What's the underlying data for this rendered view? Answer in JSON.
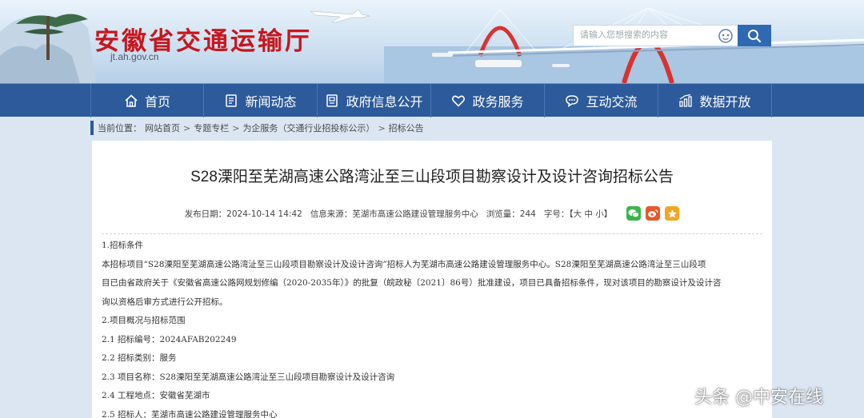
{
  "header": {
    "site_title": "安徽省交通运输厅",
    "site_domain": "jt.ah.gov.cn",
    "search_placeholder": "请输入您想搜索的内容"
  },
  "nav": {
    "items": [
      {
        "label": "首页",
        "icon": "home-icon"
      },
      {
        "label": "新闻动态",
        "icon": "news-icon"
      },
      {
        "label": "政府信息公开",
        "icon": "document-icon"
      },
      {
        "label": "政务服务",
        "icon": "heart-icon"
      },
      {
        "label": "互动交流",
        "icon": "chat-icon"
      },
      {
        "label": "数据开放",
        "icon": "chart-icon"
      }
    ]
  },
  "breadcrumb": {
    "prefix": "当前位置：",
    "items": [
      "网站首页",
      "专题专栏",
      "为企服务（交通行业招投标公示）",
      "招标公告"
    ],
    "separator": ">"
  },
  "article": {
    "title": "S28溧阳至芜湖高速公路湾沚至三山段项目勘察设计及设计咨询招标公告",
    "publish_date": "发布日期：2024-10-14 14:42",
    "source": "信息来源：芜湖市高速公路建设管理服务中心",
    "views": "浏览量：244",
    "font_size": "字号：【大 中 小】",
    "paragraphs": [
      "1.招标条件",
      "本招标项目“S28溧阳至芜湖高速公路湾沚至三山段项目勘察设计及设计咨询”招标人为芜湖市高速公路建设管理服务中心。S28溧阳至芜湖高速公路湾沚至三山段项",
      "目已由省政府关于《安徽省高速公路网规划修编（2020-2035年）》的批复（皖政秘〔2021〕86号）批准建设，项目已具备招标条件，现对该项目的勘察设计及设计咨",
      "询以资格后审方式进行公开招标。",
      "2.项目概况与招标范围",
      "2.1   招标编号：2024AFAB202249",
      "2.2 招标类别：服务",
      "2.3 项目名称：S28溧阳至芜湖高速公路湾沚至三山段项目勘察设计及设计咨询",
      "2.4 工程地点：安徽省芜湖市",
      "2.5 招标人：芜湖市高速公路建设管理服务中心"
    ]
  },
  "watermark": "头条 @中安在线",
  "colors": {
    "title_red": "#c8161d",
    "nav_blue": "#2c5a9a",
    "search_blue": "#2f69b3",
    "wechat_green": "#3bb54a",
    "weibo_orange": "#e8562a",
    "star_yellow": "#f4a623"
  }
}
